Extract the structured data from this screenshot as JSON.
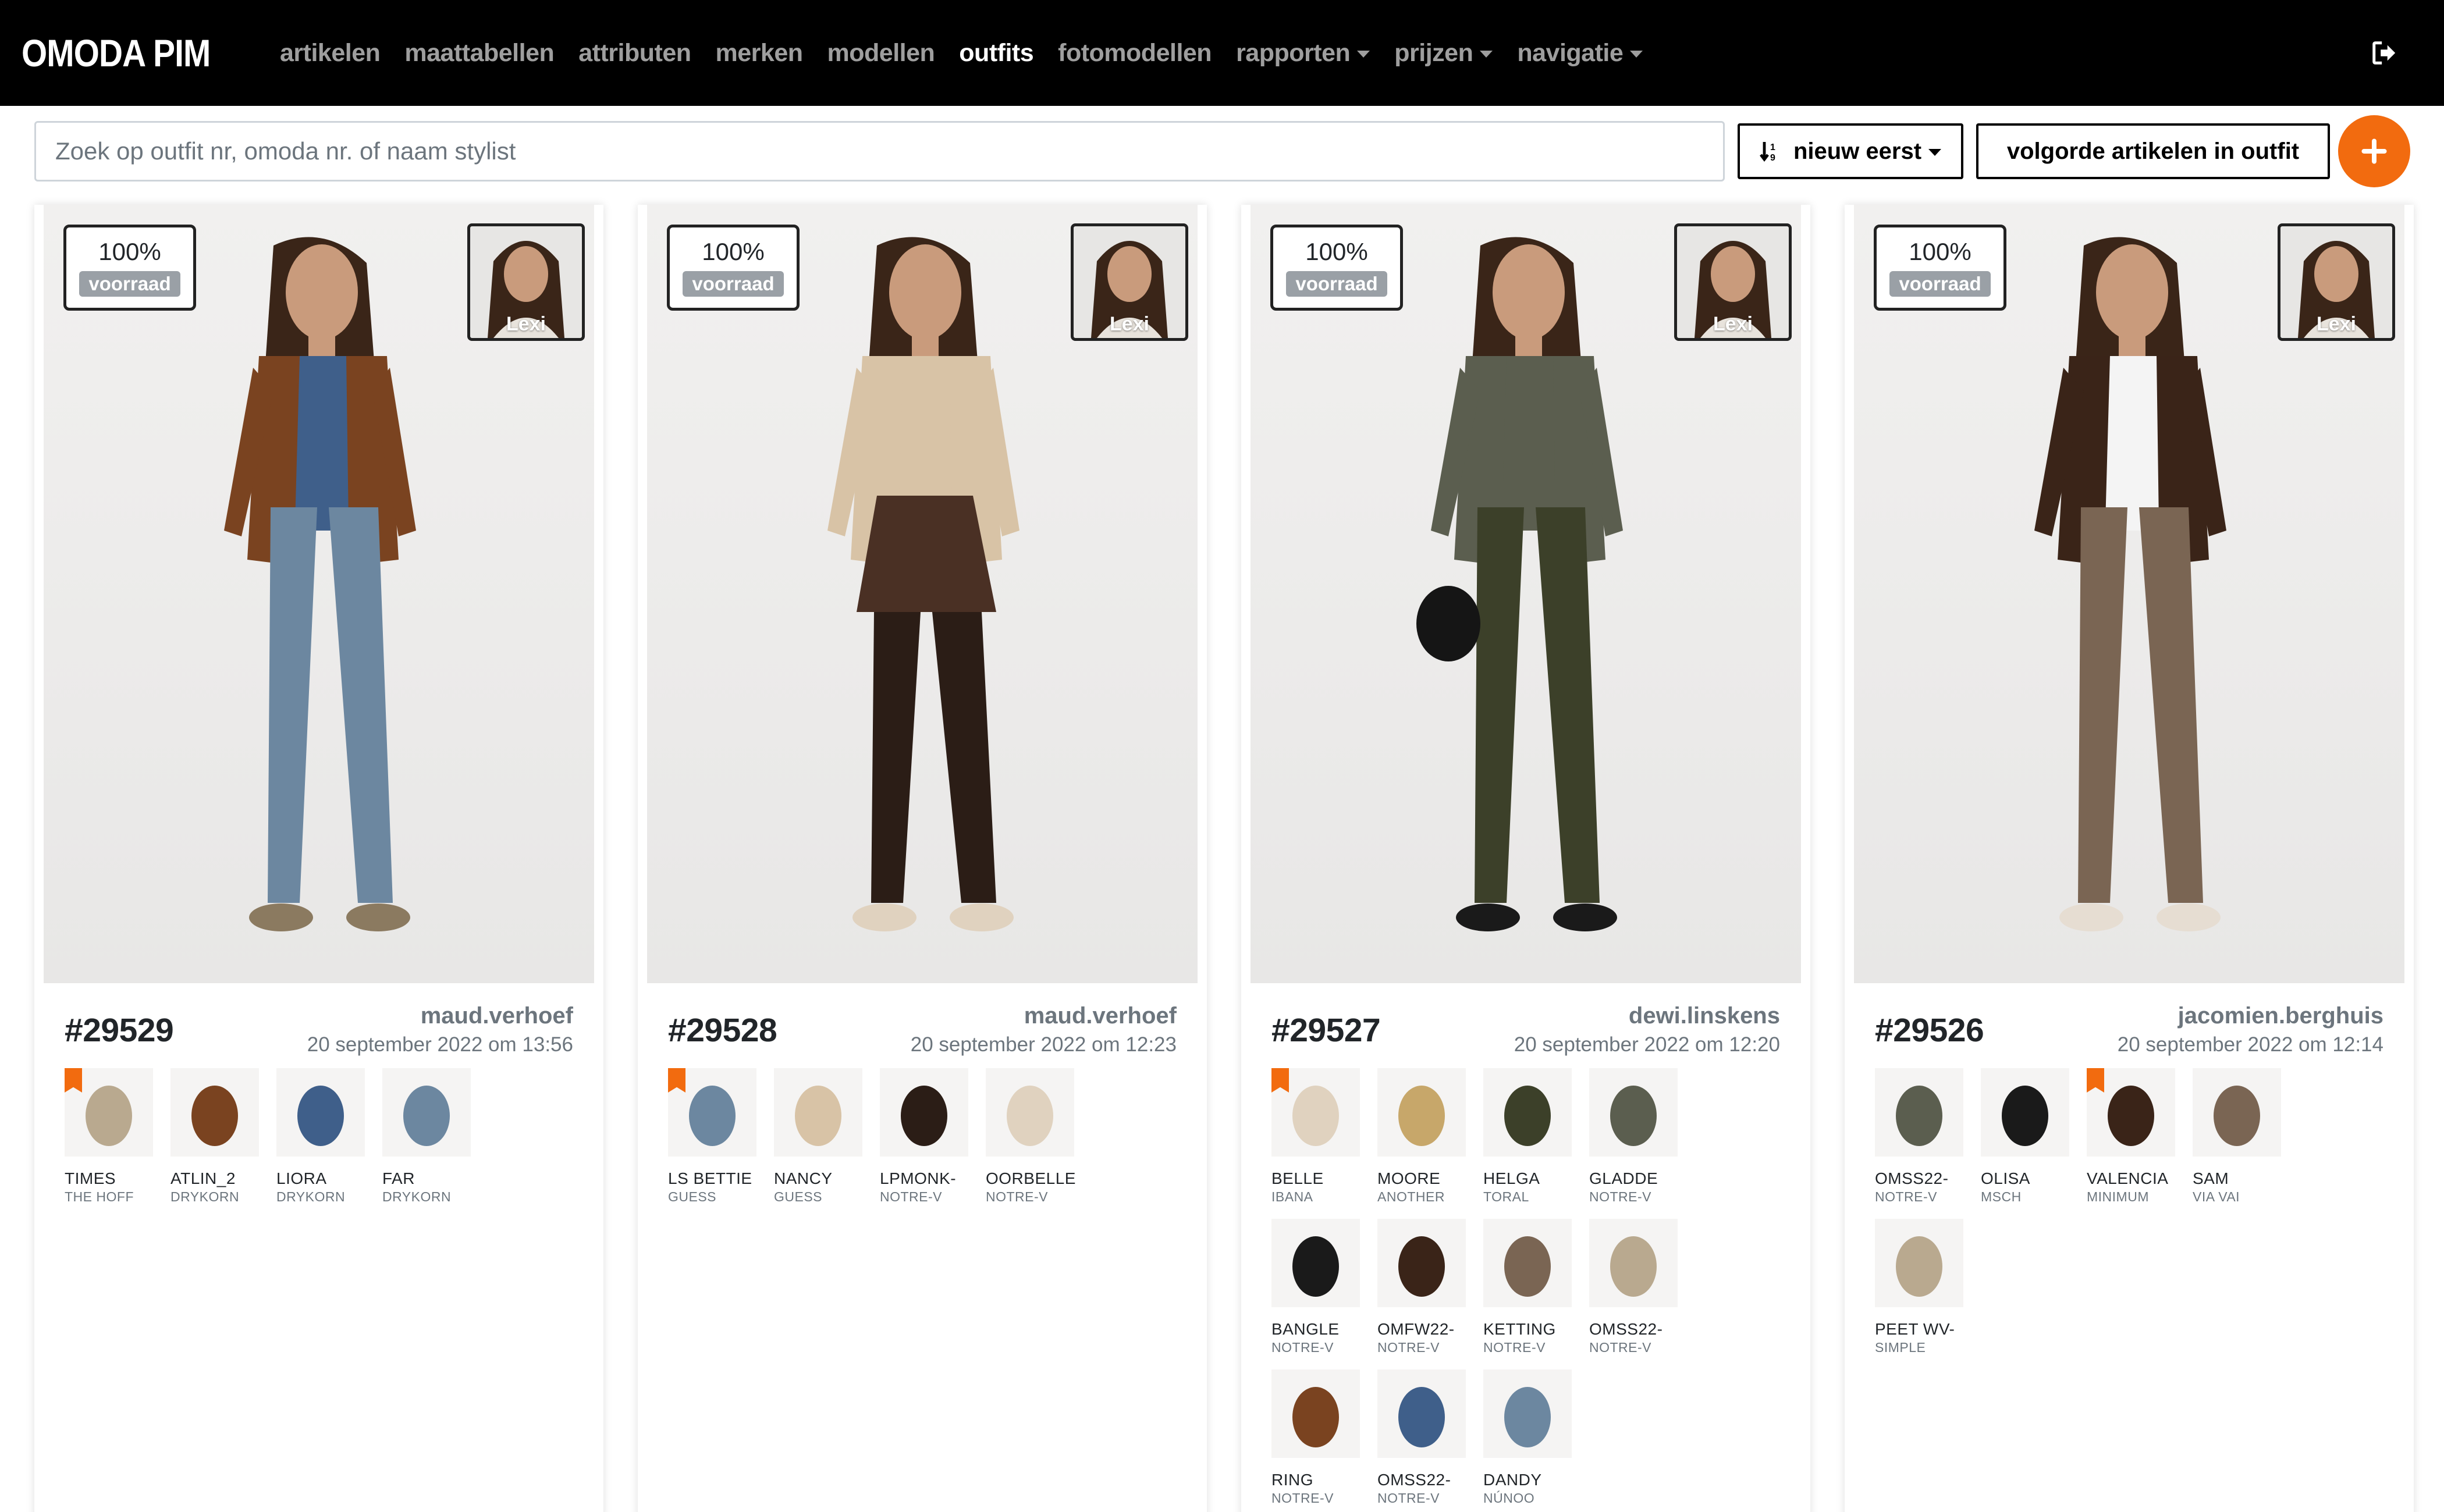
{
  "navbar": {
    "brand": "OMODA PIM",
    "items": [
      {
        "label": "artikelen",
        "dropdown": false,
        "active": false
      },
      {
        "label": "maattabellen",
        "dropdown": false,
        "active": false
      },
      {
        "label": "attributen",
        "dropdown": false,
        "active": false
      },
      {
        "label": "merken",
        "dropdown": false,
        "active": false
      },
      {
        "label": "modellen",
        "dropdown": false,
        "active": false
      },
      {
        "label": "outfits",
        "dropdown": false,
        "active": true
      },
      {
        "label": "fotomodellen",
        "dropdown": false,
        "active": false
      },
      {
        "label": "rapporten",
        "dropdown": true,
        "active": false
      },
      {
        "label": "prijzen",
        "dropdown": true,
        "active": false
      },
      {
        "label": "navigatie",
        "dropdown": true,
        "active": false
      }
    ],
    "logout_icon": "sign-out-icon"
  },
  "toolbar": {
    "search_placeholder": "Zoek op outfit nr, omoda nr. of naam stylist",
    "sort_label": "nieuw eerst",
    "order_label": "volgorde artikelen in outfit",
    "add_icon": "plus-icon"
  },
  "colors": {
    "accent": "#f26b0f",
    "navbar": "#000000",
    "badge": "#9aa0a6"
  },
  "outfits": [
    {
      "stock_percent": "100%",
      "stock_label": "voorraad",
      "model_name": "Lexi",
      "id": "#29529",
      "stylist": "maud.verhoef",
      "date": "20 september 2022 om 13:56",
      "items": [
        {
          "name": "TIMES",
          "brand": "THE HOFF",
          "flag": true
        },
        {
          "name": "ATLIN_2",
          "brand": "DRYKORN",
          "flag": false
        },
        {
          "name": "LIORA",
          "brand": "DRYKORN",
          "flag": false
        },
        {
          "name": "FAR",
          "brand": "DRYKORN",
          "flag": false
        }
      ]
    },
    {
      "stock_percent": "100%",
      "stock_label": "voorraad",
      "model_name": "Lexi",
      "id": "#29528",
      "stylist": "maud.verhoef",
      "date": "20 september 2022 om 12:23",
      "items": [
        {
          "name": "LS BETTIE",
          "brand": "GUESS",
          "flag": true
        },
        {
          "name": "NANCY",
          "brand": "GUESS",
          "flag": false
        },
        {
          "name": "LPMONK-",
          "brand": "NOTRE-V",
          "flag": false
        },
        {
          "name": "OORBELLE",
          "brand": "NOTRE-V",
          "flag": false
        }
      ]
    },
    {
      "stock_percent": "100%",
      "stock_label": "voorraad",
      "model_name": "Lexi",
      "id": "#29527",
      "stylist": "dewi.linskens",
      "date": "20 september 2022 om 12:20",
      "items": [
        {
          "name": "BELLE",
          "brand": "IBANA",
          "flag": true
        },
        {
          "name": "MOORE",
          "brand": "ANOTHER",
          "flag": false
        },
        {
          "name": "HELGA",
          "brand": "TORAL",
          "flag": false
        },
        {
          "name": "GLADDE",
          "brand": "NOTRE-V",
          "flag": false
        },
        {
          "name": "BANGLE",
          "brand": "NOTRE-V",
          "flag": false
        },
        {
          "name": "OMFW22-",
          "brand": "NOTRE-V",
          "flag": false
        },
        {
          "name": "KETTING",
          "brand": "NOTRE-V",
          "flag": false
        },
        {
          "name": "OMSS22-",
          "brand": "NOTRE-V",
          "flag": false
        },
        {
          "name": "RING",
          "brand": "NOTRE-V",
          "flag": false
        },
        {
          "name": "OMSS22-",
          "brand": "NOTRE-V",
          "flag": false
        },
        {
          "name": "DANDY",
          "brand": "NÚNOO",
          "flag": false
        }
      ]
    },
    {
      "stock_percent": "100%",
      "stock_label": "voorraad",
      "model_name": "Lexi",
      "id": "#29526",
      "stylist": "jacomien.berghuis",
      "date": "20 september 2022 om 12:14",
      "items": [
        {
          "name": "OMSS22-",
          "brand": "NOTRE-V",
          "flag": false
        },
        {
          "name": "OLISA",
          "brand": "MSCH",
          "flag": false
        },
        {
          "name": "VALENCIA",
          "brand": "MINIMUM",
          "flag": true
        },
        {
          "name": "SAM",
          "brand": "VIA VAI",
          "flag": false
        },
        {
          "name": "PEET WV-",
          "brand": "SIMPLE",
          "flag": false
        }
      ]
    }
  ]
}
